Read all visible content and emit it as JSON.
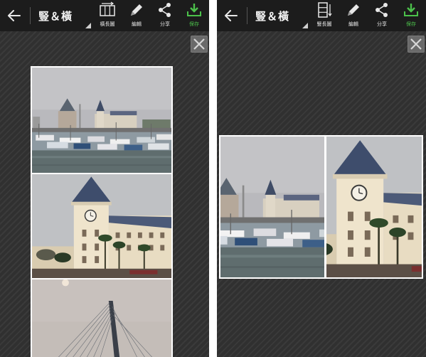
{
  "toolbar": {
    "mode_label": "豎＆橫",
    "vertical_label": "橫長圖",
    "edit_label": "編輯",
    "share_label": "分享",
    "save_label": "保存",
    "horizontal_label": "豎長圖"
  },
  "colors": {
    "toolbar_bg": "#1c1c1c",
    "canvas_bg": "#333333",
    "save_green": "#4cc14b"
  },
  "icons": {
    "back": "arrow-left-icon",
    "long_horizontal": "horizontal-long-image-icon",
    "long_vertical": "vertical-long-image-icon",
    "edit": "pencil-icon",
    "share": "share-icon",
    "save": "download-icon",
    "close": "close-icon"
  },
  "screens": [
    {
      "layout": "vertical",
      "photos": [
        "harbor",
        "clock-tower",
        "bridge"
      ]
    },
    {
      "layout": "horizontal",
      "photos": [
        "harbor",
        "clock-tower"
      ]
    }
  ]
}
